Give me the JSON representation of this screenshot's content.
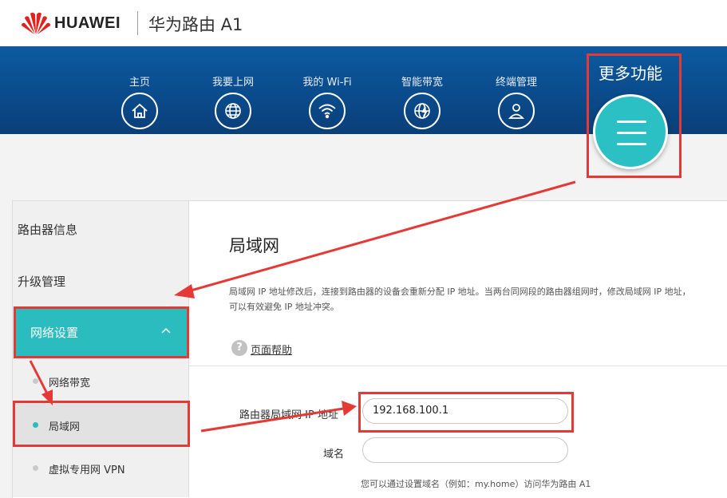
{
  "brand": {
    "company": "HUAWEI",
    "product": "华为路由 A1"
  },
  "nav": {
    "items": [
      {
        "label": "主页",
        "icon": "home-icon"
      },
      {
        "label": "我要上网",
        "icon": "globe-icon"
      },
      {
        "label": "我的 Wi-Fi",
        "icon": "wifi-icon"
      },
      {
        "label": "智能带宽",
        "icon": "globe-bolt-icon"
      },
      {
        "label": "终端管理",
        "icon": "user-icon"
      }
    ],
    "more_label": "更多功能",
    "more_icon": "menu-icon"
  },
  "sidebar": {
    "items": [
      "路由器信息",
      "升级管理",
      "网络设置"
    ],
    "sub_items": [
      "网络带宽",
      "局域网",
      "虚拟专用网 VPN"
    ]
  },
  "main": {
    "title": "局域网",
    "description_line1": "局域网 IP 地址修改后，连接到路由器的设备会重新分配 IP 地址。当两台同网段的路由器组网时，修改局域网 IP 地址，",
    "description_line2": "可以有效避免 IP 地址冲突。",
    "help_link": "页面帮助",
    "ip_label": "路由器局域网 IP 地址",
    "ip_value": "192.168.100.1",
    "domain_label": "域名",
    "domain_value": "",
    "domain_hint": "您可以通过设置域名（例如：my.home）访问华为路由 A1"
  },
  "colors": {
    "accent": "#2bbcc0",
    "banner": "#0a4a8a",
    "annotation_red": "#e53935"
  }
}
